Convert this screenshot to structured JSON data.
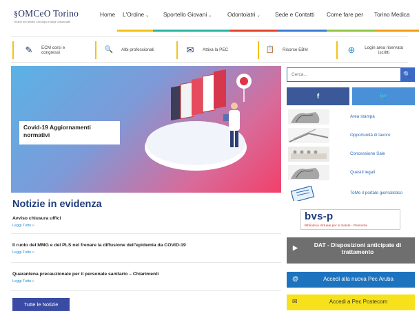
{
  "header": {
    "logo_text": "OMCeO Torino",
    "logo_subtitle": "Ordine dei Medici Chirurghi e degli Odontoiatri",
    "nav": [
      {
        "label": "Home",
        "dropdown": false
      },
      {
        "label": "L'Ordine",
        "dropdown": true
      },
      {
        "label": "Sportello Giovani",
        "dropdown": true
      },
      {
        "label": "Odontoiatri",
        "dropdown": true
      },
      {
        "label": "Sede e Contatti",
        "dropdown": false
      },
      {
        "label": "Come fare per",
        "dropdown": false
      },
      {
        "label": "Torino Medica",
        "dropdown": false
      }
    ],
    "caret": "⌄",
    "colors": [
      "#f3c219",
      "#2bb3a3",
      "#e1412b",
      "#3a7bd5",
      "#8fc542",
      "#f39c12"
    ]
  },
  "quicklinks": [
    {
      "label": "ECM corsi e congressi",
      "icon": "pencil-icon",
      "glyph": "✎"
    },
    {
      "label": "Albi professionali",
      "icon": "search-icon",
      "glyph": "🔍"
    },
    {
      "label": "Attiva la PEC",
      "icon": "pec-icon",
      "glyph": "✉"
    },
    {
      "label": "Risorse EBM",
      "icon": "clipboard-icon",
      "glyph": "📋"
    },
    {
      "label": "Login area riservata iscritti",
      "icon": "login-icon",
      "glyph": "⊕"
    }
  ],
  "hero": {
    "caption": "Covid-19 Aggiornamenti normativi"
  },
  "notizie": {
    "title": "Notizie in evidenza",
    "items": [
      {
        "title": "Avviso chiusura uffici",
        "read_more": "Leggi Tutto »"
      },
      {
        "title": "Il ruolo del MMG e del PLS nel frenare la diffusione dell'epidemia da COVID-19",
        "read_more": "Leggi Tutto »"
      },
      {
        "title": "Quarantena precauzionale per il personale sanitario – Chiarimenti",
        "read_more": "Leggi Tutto »"
      }
    ],
    "all_button": "Tutte le Notizie"
  },
  "sidebar": {
    "search_placeholder": "Cerca...",
    "search_icon": "🔍",
    "facebook_glyph": "f",
    "twitter_glyph": "🐦",
    "facebook_color": "#3b5998",
    "twitter_color": "#4a90d9",
    "items": [
      {
        "label": "Area stampa"
      },
      {
        "label": "Opportunità di lavoro"
      },
      {
        "label": "Concessione Sale"
      },
      {
        "label": "Quesiti legali"
      },
      {
        "label": "ToMe il portale giornalistico"
      }
    ],
    "bvs": {
      "logo": "bvs-p",
      "tagline": "Biblioteca Virtuale per la Salute - Piemonte"
    },
    "dat": {
      "label": "DAT - Disposizioni anticipate di trattamento",
      "color": "#6f6f6f",
      "icon_glyph": "▶"
    },
    "pec_aruba": {
      "label": "Accedi alla nuova Pec Aruba",
      "color": "#1e73be",
      "icon_glyph": "@"
    },
    "pec_postecom": {
      "label": "Accedi a Pec Postecom",
      "color": "#f7e11b",
      "icon_glyph": "✉"
    }
  }
}
